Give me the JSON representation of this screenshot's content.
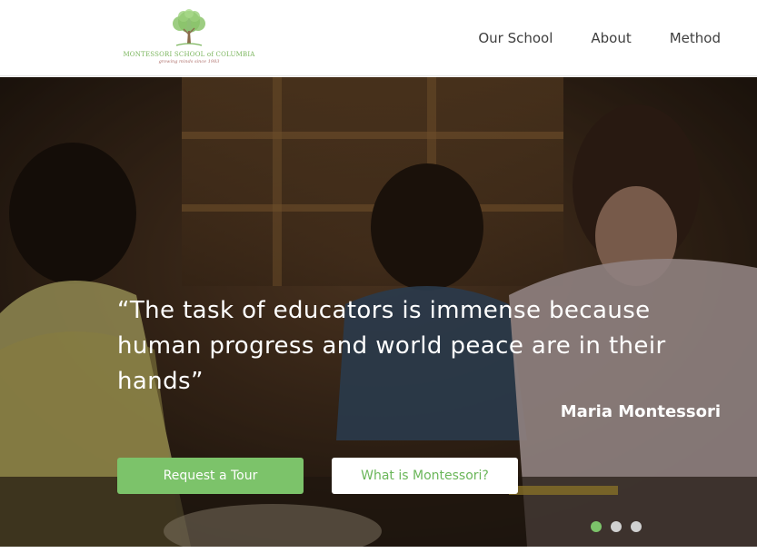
{
  "logo": {
    "name": "MONTESSORI SCHOOL of COLUMBIA",
    "tagline": "growing minds since 1983"
  },
  "nav": {
    "items": [
      {
        "label": "Our School"
      },
      {
        "label": "About"
      },
      {
        "label": "Method"
      }
    ]
  },
  "hero": {
    "quote": "“The task of educators is immense because human progress and world peace are in their hands”",
    "author": "Maria Montessori",
    "primary_button": "Request a Tour",
    "secondary_button": "What is Montessori?",
    "slides": {
      "count": 3,
      "active_index": 0
    }
  },
  "colors": {
    "accent_green": "#7cc36a",
    "logo_green": "#7ab55c",
    "nav_text": "#3f3f3f"
  },
  "icons": [
    "tree-logo-icon"
  ]
}
